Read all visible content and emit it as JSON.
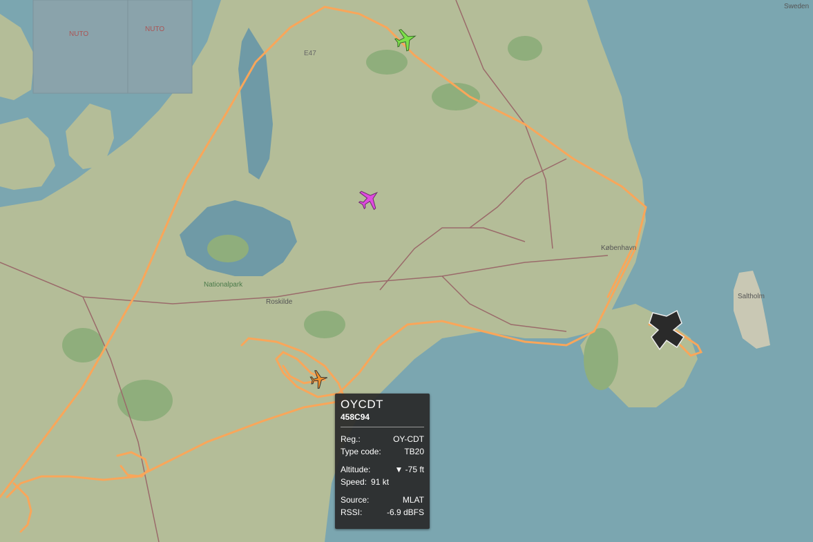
{
  "map": {
    "labels": [
      {
        "name": "label-top-left-1",
        "text": "NUTO"
      },
      {
        "name": "label-top-left-2",
        "text": "NUTO"
      },
      {
        "name": "label-town-north",
        "text": "E47"
      },
      {
        "name": "label-national-park",
        "text": "Nationalpark"
      },
      {
        "name": "label-roskilde",
        "text": "Roskilde"
      },
      {
        "name": "label-copenhagen",
        "text": "København"
      },
      {
        "name": "label-island",
        "text": "Saltholm"
      },
      {
        "name": "label-top-right",
        "text": "Sweden"
      }
    ],
    "aircraft": [
      {
        "name": "aircraft-green",
        "color": "#7de04a"
      },
      {
        "name": "aircraft-magenta",
        "color": "#e04ae0"
      },
      {
        "name": "aircraft-orange-selected",
        "color": "#f0902a"
      },
      {
        "name": "airport-kastrup",
        "color": "#000000"
      }
    ],
    "track_color": "#f9a65a"
  },
  "tooltip": {
    "callsign": "OYCDT",
    "hex": "458C94",
    "reg_label": "Reg.:",
    "reg_value": "OY-CDT",
    "type_label": "Type code:",
    "type_value": "TB20",
    "alt_label": "Altitude:",
    "alt_value": "▼ -75 ft",
    "speed_label": "Speed:",
    "speed_value": "91 kt",
    "source_label": "Source:",
    "source_value": "MLAT",
    "rssi_label": "RSSI:",
    "rssi_value": "-6.9 dBFS"
  }
}
